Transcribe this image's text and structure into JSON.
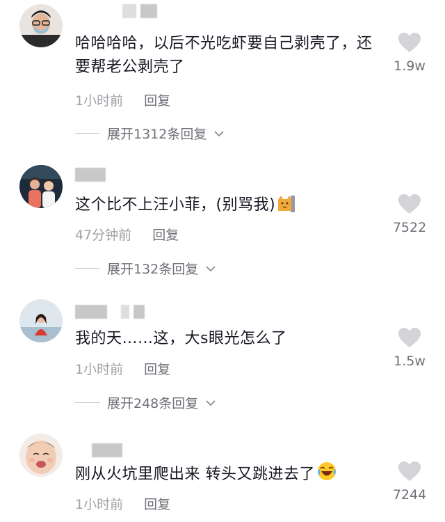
{
  "comments": [
    {
      "text": "哈哈哈哈，以后不光吃虾要自己剥壳了，还要帮老公剥壳了",
      "time": "1小时前",
      "reply": "回复",
      "likes": "1.9w",
      "expand": "展开1312条回复"
    },
    {
      "text": "这个比不上汪小菲，(别骂我)",
      "time": "47分钟前",
      "reply": "回复",
      "likes": "7522",
      "expand": "展开132条回复"
    },
    {
      "text": "我的天……这，大s眼光怎么了",
      "time": "1小时前",
      "reply": "回复",
      "likes": "1.5w",
      "expand": "展开248条回复"
    },
    {
      "text": "刚从火坑里爬出来 转头又跳进去了",
      "time": "1小时前",
      "reply": "回复",
      "likes": "7244"
    }
  ],
  "icons": {
    "like": "heart-icon",
    "expand": "chevron-down-icon",
    "emoji_2": "cat-emoji-icon",
    "emoji_4": "laughing-emoji-icon"
  },
  "colors": {
    "text": "#161823",
    "meta": "#a0a0a6",
    "heart": "#d4d4d8"
  }
}
